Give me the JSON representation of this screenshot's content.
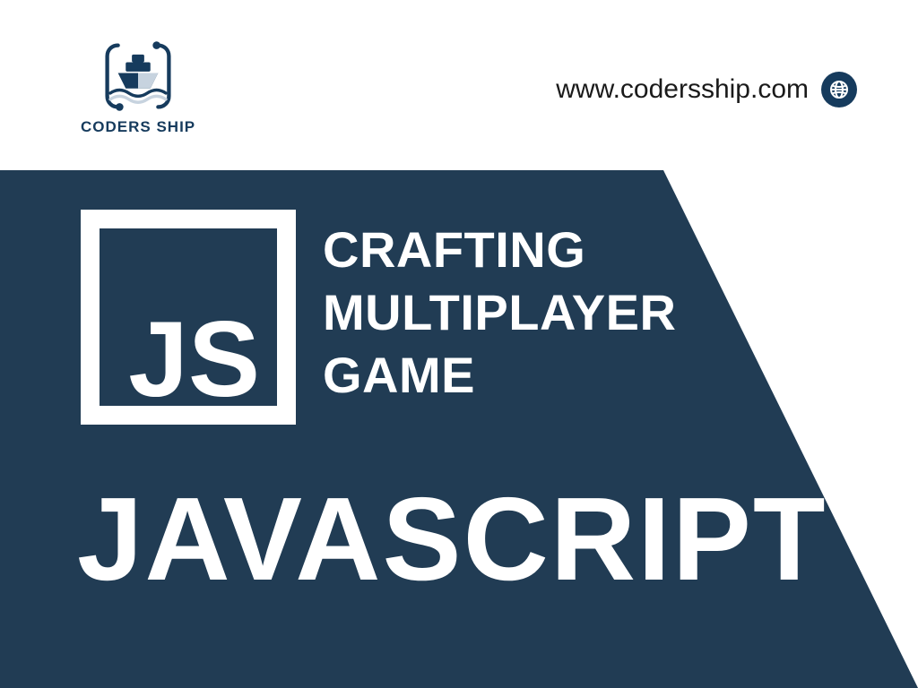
{
  "brand": {
    "name": "CODERS SHIP",
    "color_primary": "#163b5d",
    "color_light": "#c7d3df"
  },
  "header": {
    "url": "www.codersship.com"
  },
  "panel": {
    "js_label": "JS",
    "heading_line1": "CRAFTING",
    "heading_line2": "MULTIPLAYER",
    "heading_line3": "GAME",
    "big_word": "JAVASCRIPT",
    "bg_color": "#213c54",
    "text_color": "#ffffff"
  }
}
